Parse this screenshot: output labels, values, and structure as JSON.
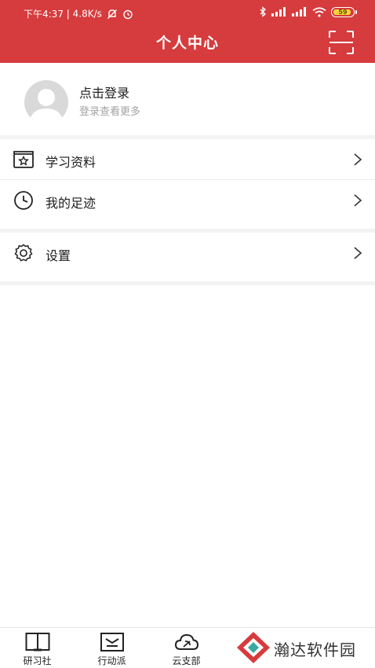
{
  "status_bar": {
    "time": "下午4:37",
    "separator": "|",
    "net_speed": "4.8K/s",
    "battery": "59"
  },
  "header": {
    "title": "个人中心"
  },
  "profile": {
    "login_title": "点击登录",
    "login_subtitle": "登录查看更多"
  },
  "menu": {
    "study_materials": "学习资料",
    "my_footprints": "我的足迹",
    "settings": "设置"
  },
  "bottom_nav": [
    {
      "label": "研习社",
      "icon": "book-icon"
    },
    {
      "label": "行动派",
      "icon": "flag-icon"
    },
    {
      "label": "云支部",
      "icon": "cloud-party-icon"
    }
  ],
  "watermark": {
    "text": "瀚达软件园"
  },
  "colors": {
    "header_bg": "#d63b3d",
    "battery": "#f6d23c"
  }
}
